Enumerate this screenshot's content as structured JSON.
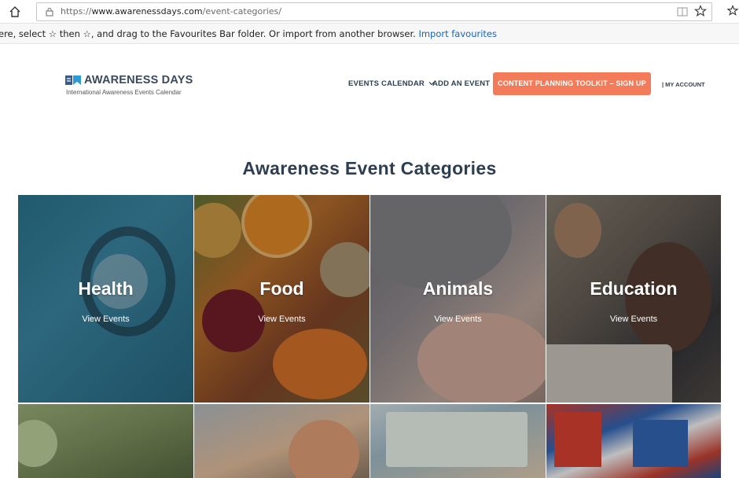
{
  "browser": {
    "url_prefix": "https://",
    "url_host": "www.awarenessdays.com",
    "url_path": "/event-categories/",
    "favbar_message": "ere, select ☆ then ☆, and drag to the Favourites Bar folder. Or import from another browser.",
    "favbar_link": "Import favourites"
  },
  "site": {
    "logo_title": "AWARENESS DAYS",
    "logo_sub": "International Awareness Events Calendar",
    "nav": {
      "events_calendar": "EVENTS CALENDAR",
      "add_event": "ADD AN EVENT",
      "cta": "CONTENT PLANNING TOOLKIT – SIGN UP",
      "account": "| MY ACCOUNT"
    }
  },
  "page": {
    "title": "Awareness Event Categories",
    "categories": [
      {
        "name": "Health",
        "link": "View Events"
      },
      {
        "name": "Food",
        "link": "View Events"
      },
      {
        "name": "Animals",
        "link": "View Events"
      },
      {
        "name": "Education",
        "link": "View Events"
      }
    ]
  },
  "colors": {
    "brand_text": "#2c3e50",
    "cta": "#f37b59",
    "link": "#1565c0"
  },
  "icons": [
    "home-icon",
    "lock-icon",
    "reader-view-icon",
    "star-icon",
    "favourites-icon",
    "chevron-down-icon",
    "logo-mark-icon"
  ]
}
